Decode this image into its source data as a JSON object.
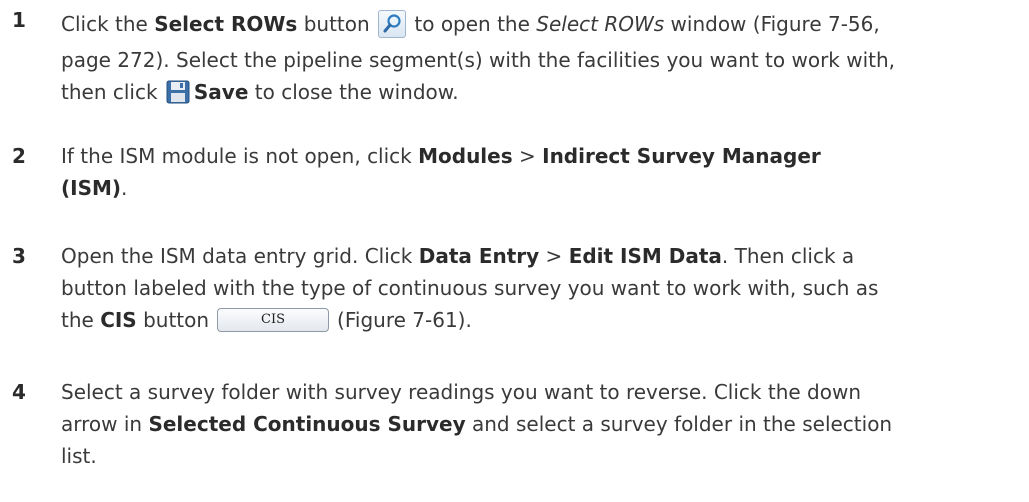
{
  "steps": [
    {
      "number": "1",
      "parts": {
        "a": "Click the ",
        "b": "Select ROWs",
        "c": " button ",
        "d": " to open the ",
        "e": "Select ROWs",
        "f": " window (Figure 7-56,",
        "g": "page 272). Select the pipeline segment(s) with the facilities you want to work with,",
        "h": "then click ",
        "i": "Save",
        "j": " to close the window."
      }
    },
    {
      "number": "2",
      "parts": {
        "a": "If the ISM module is not open, click ",
        "b": "Modules",
        "c": " > ",
        "d": "Indirect Survey Manager",
        "e": "(ISM)",
        "f": "."
      }
    },
    {
      "number": "3",
      "parts": {
        "a": "Open the ISM data entry grid. Click ",
        "b": "Data Entry",
        "c": " > ",
        "d": "Edit ISM Data",
        "e": ". Then click a",
        "f": "button labeled with the type of continuous survey you want to work with, such as",
        "g": "the ",
        "h": "CIS",
        "i": " button",
        "j": "(Figure 7-61)."
      },
      "cis_button_label": "CIS"
    },
    {
      "number": "4",
      "parts": {
        "a": "Select a survey folder with survey readings you want to reverse. Click the down",
        "b": "arrow in ",
        "c": "Selected Continuous Survey",
        "d": " and select a survey folder in the selection",
        "e": "list."
      }
    }
  ],
  "icons": {
    "select_rows": "magnifier-icon",
    "save": "floppy-disk-icon"
  }
}
